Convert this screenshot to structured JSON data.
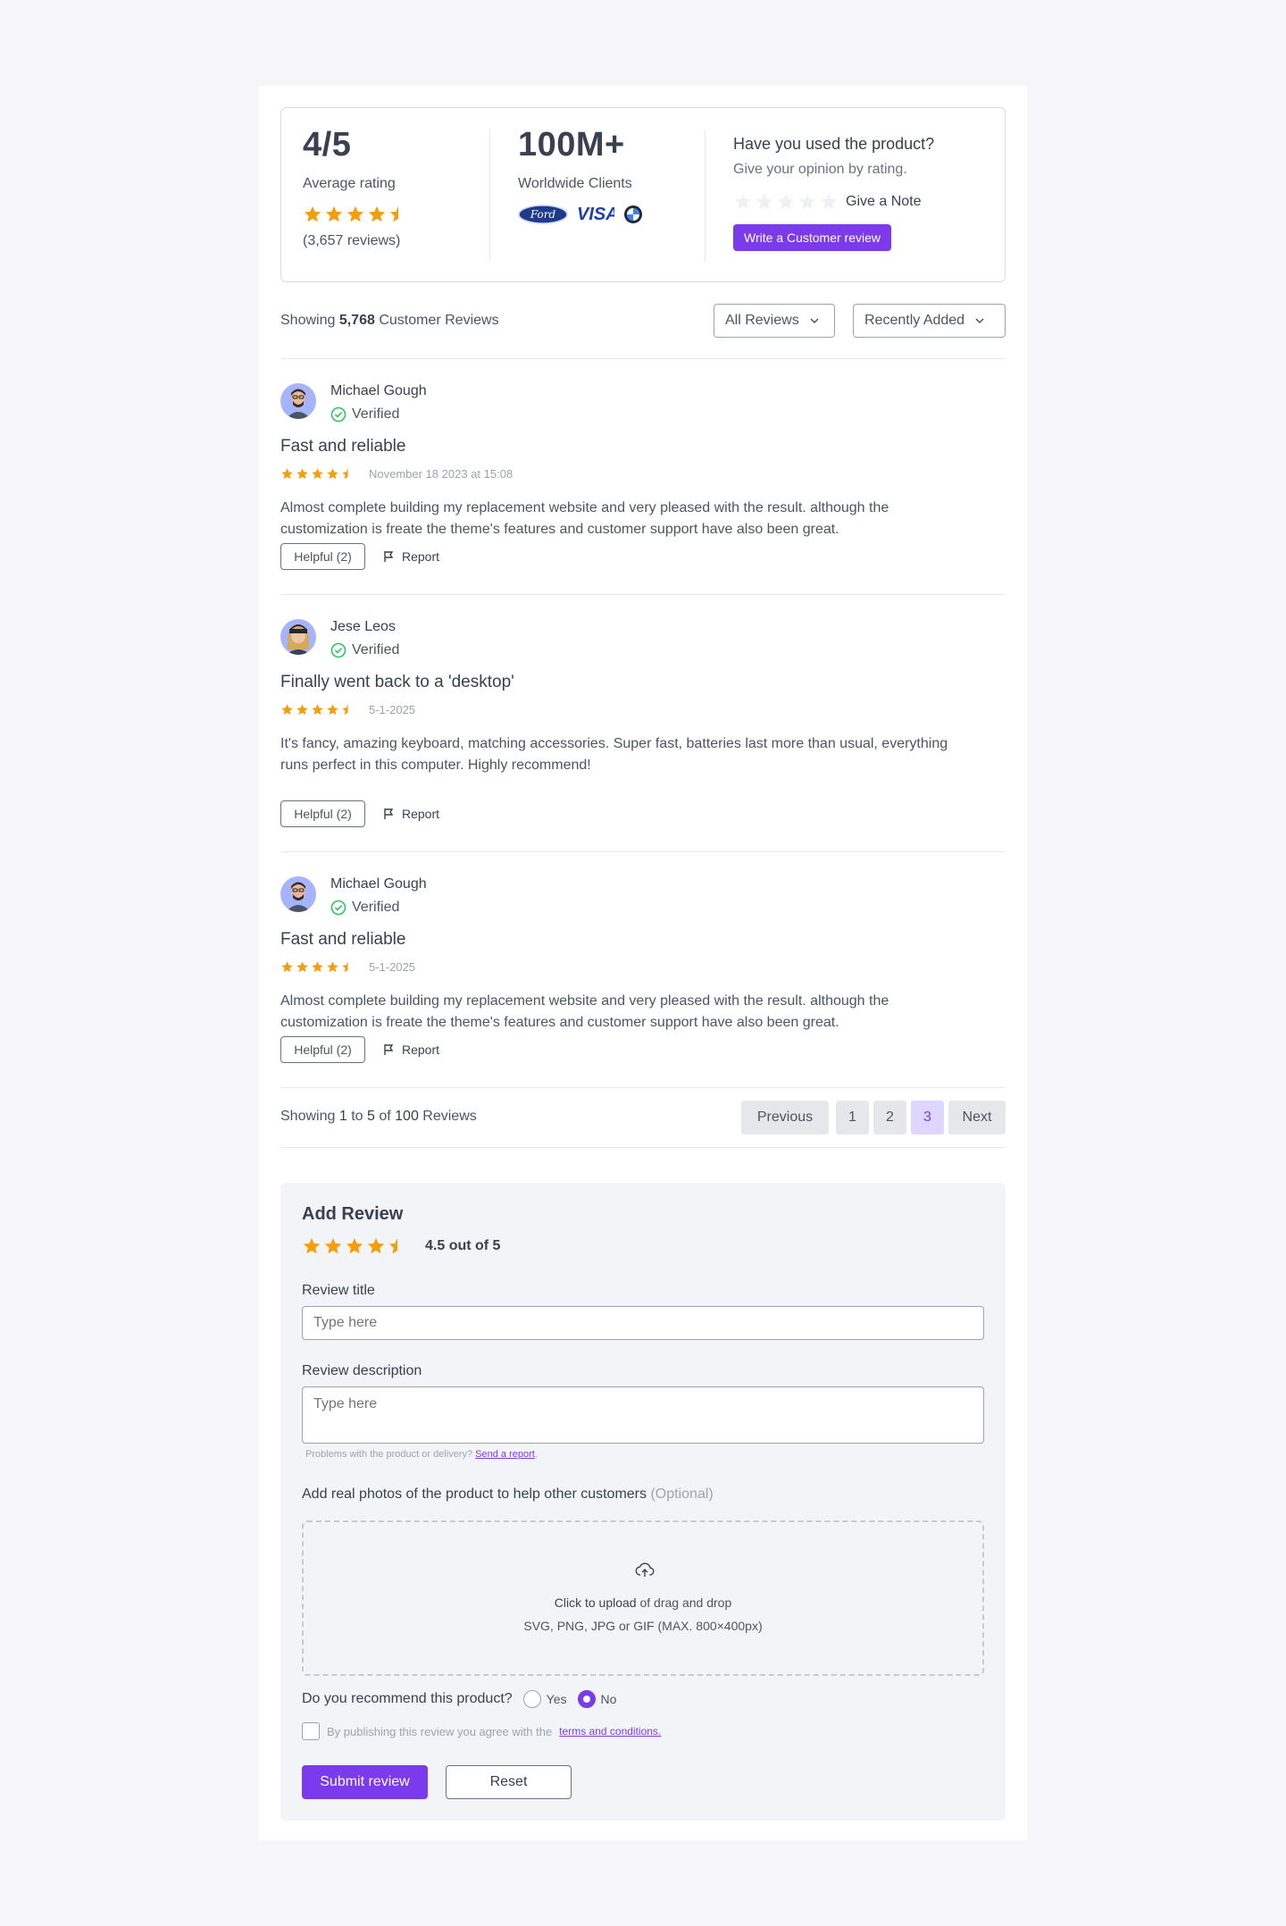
{
  "colors": {
    "accent": "#7c3aed",
    "star": "#f59e0b",
    "verified": "#22c55e"
  },
  "summary": {
    "rating_value": "4/5",
    "rating_label": "Average rating",
    "rating_stars": 4.5,
    "reviews_count": "(3,657 reviews)",
    "clients_value": "100M+",
    "clients_label": "Worldwide Clients",
    "client_logos": [
      "Ford",
      "VISA",
      "bmw-logo"
    ],
    "cta_title": "Have you used the product?",
    "cta_subtitle": "Give your opinion by rating.",
    "give_note_label": "Give a Note",
    "write_review_label": "Write a Customer review"
  },
  "toolbar": {
    "showing_prefix": "Showing",
    "showing_count": "5,768",
    "showing_suffix": "Customer Reviews",
    "filter_label": "All Reviews",
    "sort_label": "Recently Added"
  },
  "reviews": [
    {
      "name": "Michael Gough",
      "verified_label": "Verified",
      "title": "Fast and reliable",
      "rating": 4.5,
      "date": "November 18 2023 at 15:08",
      "body": "Almost complete building my replacement website and very pleased with the result. although the customization is freate the theme's features and customer support have also been great.",
      "helpful_label": "Helpful (2)",
      "report_label": "Report"
    },
    {
      "name": "Jese Leos",
      "verified_label": "Verified",
      "title": "Finally went back to a 'desktop'",
      "rating": 4.5,
      "date": "5-1-2025",
      "body": "It's fancy, amazing keyboard, matching accessories. Super fast, batteries last more than usual, everything runs perfect in this computer. Highly recommend!",
      "helpful_label": "Helpful (2)",
      "report_label": "Report"
    },
    {
      "name": "Michael Gough",
      "verified_label": "Verified",
      "title": "Fast and reliable",
      "rating": 4.5,
      "date": "5-1-2025",
      "body": "Almost complete building my replacement website and very pleased with the result. although the customization is freate the theme's features and customer support have also been great.",
      "helpful_label": "Helpful (2)",
      "report_label": "Report"
    }
  ],
  "pagination": {
    "showing": "Showing",
    "from": "1",
    "to_word": "to",
    "to": "5",
    "of_word": "of",
    "total": "100",
    "suffix": "Reviews",
    "prev_label": "Previous",
    "pages": [
      "1",
      "2",
      "3"
    ],
    "current_page": "3",
    "next_label": "Next"
  },
  "add_review": {
    "title": "Add Review",
    "rating": 4.5,
    "rating_text": "4.5 out of 5",
    "review_title_label": "Review title",
    "review_title_placeholder": "Type here",
    "description_label": "Review description",
    "description_placeholder": "Type here",
    "hint_text": "Problems with the product or delivery?",
    "hint_link": "Send a report",
    "hint_end": ".",
    "photos_label": "Add real photos of the product to help other customers",
    "photos_optional": "(Optional)",
    "upload_cta": "Click to upload",
    "upload_rest": "of drag and drop",
    "upload_formats": "SVG, PNG, JPG or GIF (MAX. 800×400px)",
    "recommend_question": "Do you recommend this product?",
    "yes_label": "Yes",
    "no_label": "No",
    "recommend_selected": "No",
    "terms_text": "By publishing this review you agree with the",
    "terms_link": "terms and conditions.",
    "submit_label": "Submit review",
    "reset_label": "Reset"
  }
}
